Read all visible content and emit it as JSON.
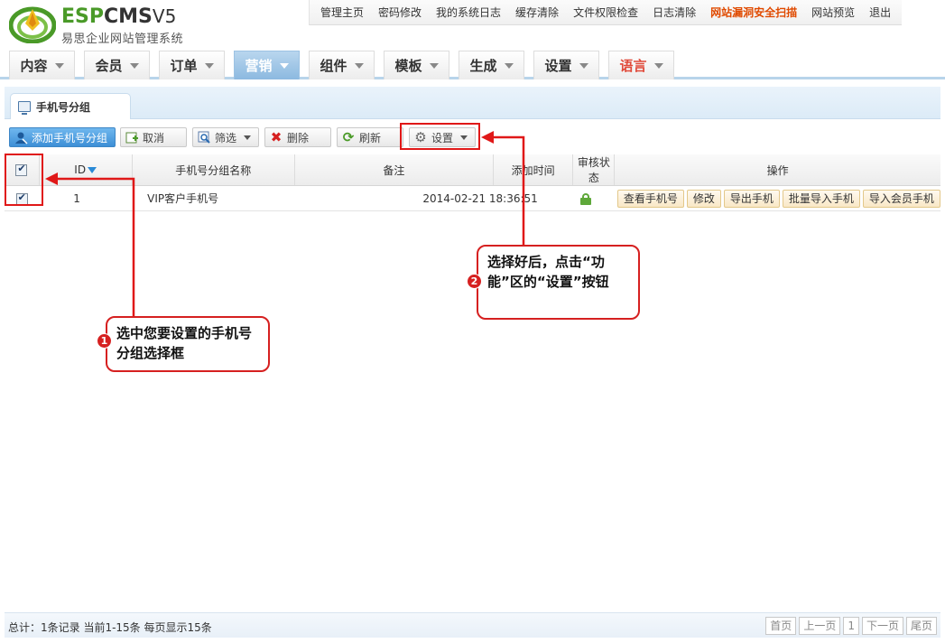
{
  "brand": {
    "name_esp": "ESP",
    "name_cms": "CMS",
    "version": "V5",
    "subtitle": "易思企业网站管理系统"
  },
  "top_links": [
    "管理主页",
    "密码修改",
    "我的系统日志",
    "缓存清除",
    "文件权限检查",
    "日志清除",
    "网站漏洞安全扫描",
    "网站预览",
    "退出"
  ],
  "main_tabs": [
    "内容",
    "会员",
    "订单",
    "营销",
    "组件",
    "模板",
    "生成",
    "设置",
    "语言"
  ],
  "panel_tab": "手机号分组",
  "toolbar": {
    "add": "添加手机号分组",
    "cancel": "取消",
    "filter": "筛选",
    "delete": "删除",
    "refresh": "刷新",
    "settings": "设置"
  },
  "table": {
    "headers": {
      "id": "ID",
      "name": "手机号分组名称",
      "remark": "备注",
      "time": "添加时间",
      "status": "审核状态",
      "ops": "操作"
    },
    "rows": [
      {
        "id": "1",
        "name": "VIP客户手机号",
        "time": "2014-02-21 18:36:51",
        "ops": [
          "查看手机号",
          "修改",
          "导出手机",
          "批量导入手机",
          "导入会员手机"
        ]
      }
    ]
  },
  "callouts": {
    "c1": {
      "num": "1",
      "text": "选中您要设置的手机号分组选择框"
    },
    "c2": {
      "num": "2",
      "text": "选择好后，点击“功能”区的“设置”按钮"
    }
  },
  "footer": {
    "summary": "总计：1条记录 当前1-15条 每页显示15条",
    "pager": [
      "首页",
      "上一页",
      "1",
      "下一页",
      "尾页"
    ]
  },
  "colors": {
    "accent_red": "#d62020",
    "active_tab": "#8cb9e0",
    "logo_green": "#4a9a28",
    "link_highlight": "#e04a00"
  }
}
